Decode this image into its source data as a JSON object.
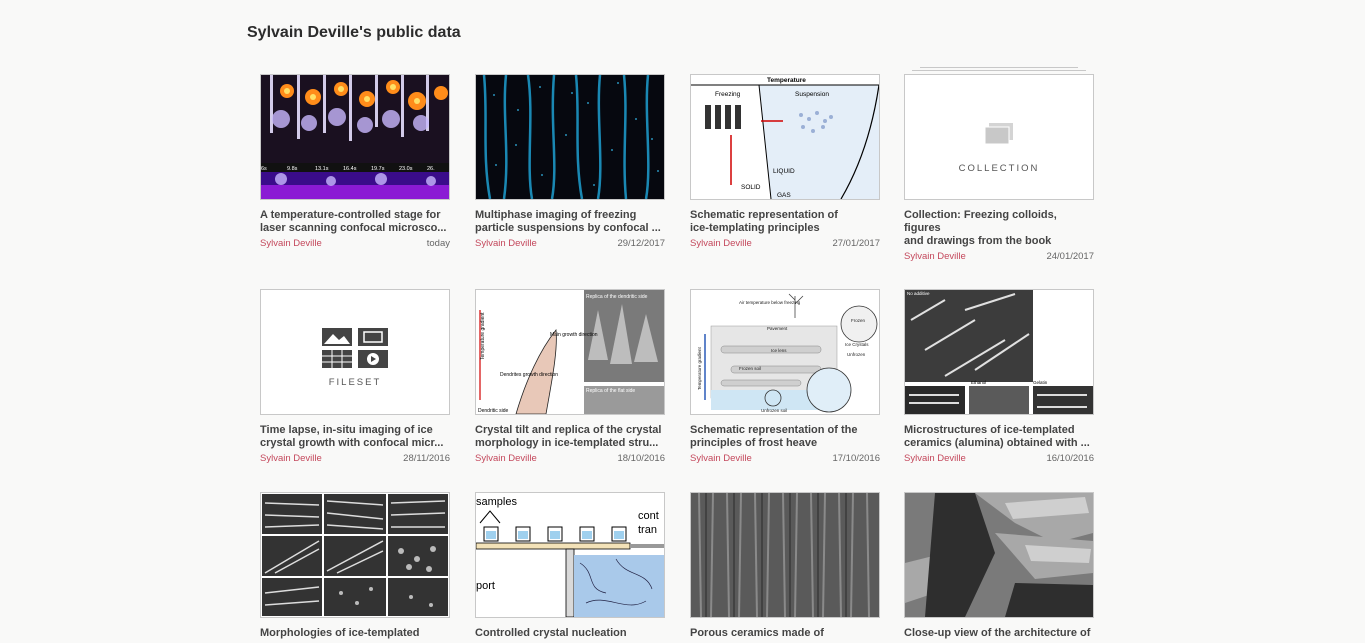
{
  "page": {
    "title": "Sylvain Deville's public data"
  },
  "items": [
    {
      "title": "A temperature-controlled stage for laser scanning confocal microsco...",
      "author": "Sylvain Deville",
      "date": "today",
      "thumb_labels": [
        "6s",
        "9.8s",
        "13.1s",
        "16.4s",
        "19.7s",
        "23.0s",
        "26."
      ]
    },
    {
      "title": "Multiphase imaging of freezing particle suspensions by confocal ...",
      "author": "Sylvain Deville",
      "date": "29/12/2017"
    },
    {
      "title": "Schematic representation of\nice-templating principles",
      "author": "Sylvain Deville",
      "date": "27/01/2017",
      "thumb_labels": [
        "Temperature",
        "Freezing",
        "Suspension",
        "LIQUID",
        "SOLID",
        "GAS"
      ]
    },
    {
      "title": "Collection: Freezing colloids, figures\nand drawings from the book",
      "author": "Sylvain Deville",
      "date": "24/01/2017",
      "placeholder": "COLLECTION"
    },
    {
      "title": "Time lapse, in-situ imaging of ice crystal growth with confocal micr...",
      "author": "Sylvain Deville",
      "date": "28/11/2016",
      "placeholder": "FILESET"
    },
    {
      "title": "Crystal tilt and replica of the crystal morphology in ice-templated stru...",
      "author": "Sylvain Deville",
      "date": "18/10/2016",
      "thumb_labels": [
        "Replica of the dendritic side",
        "Main growth direction",
        "Dendrites growth direction",
        "Replica of the flat side",
        "Temperature gradient",
        "Dendritic side"
      ]
    },
    {
      "title": "Schematic representation of the\nprinciples of frost heave",
      "author": "Sylvain Deville",
      "date": "17/10/2016",
      "thumb_labels": [
        "Air temperature below freezing",
        "Pavement",
        "Ice lens",
        "Frozen soil",
        "Unfrozen soil",
        "Frozen",
        "Ice Crystals",
        "Unfrozen",
        "Temperature gradient"
      ]
    },
    {
      "title": "Microstructures of ice-templated ceramics (alumina) obtained with ...",
      "author": "Sylvain Deville",
      "date": "16/10/2016",
      "thumb_labels": [
        "No additive",
        "Ethanol",
        "Gelatin"
      ]
    },
    {
      "title": "Morphologies of ice-templated",
      "author": "",
      "date": ""
    },
    {
      "title": "Controlled crystal nucleation",
      "author": "",
      "date": "",
      "thumb_labels": [
        "samples",
        "cont",
        "tran",
        "port"
      ]
    },
    {
      "title": "Porous ceramics made of",
      "author": "",
      "date": ""
    },
    {
      "title": "Close-up view of the architecture of",
      "author": "",
      "date": ""
    }
  ],
  "colors": {
    "accent": "#c4485c",
    "title": "#444444",
    "border": "#c8c8c8"
  }
}
